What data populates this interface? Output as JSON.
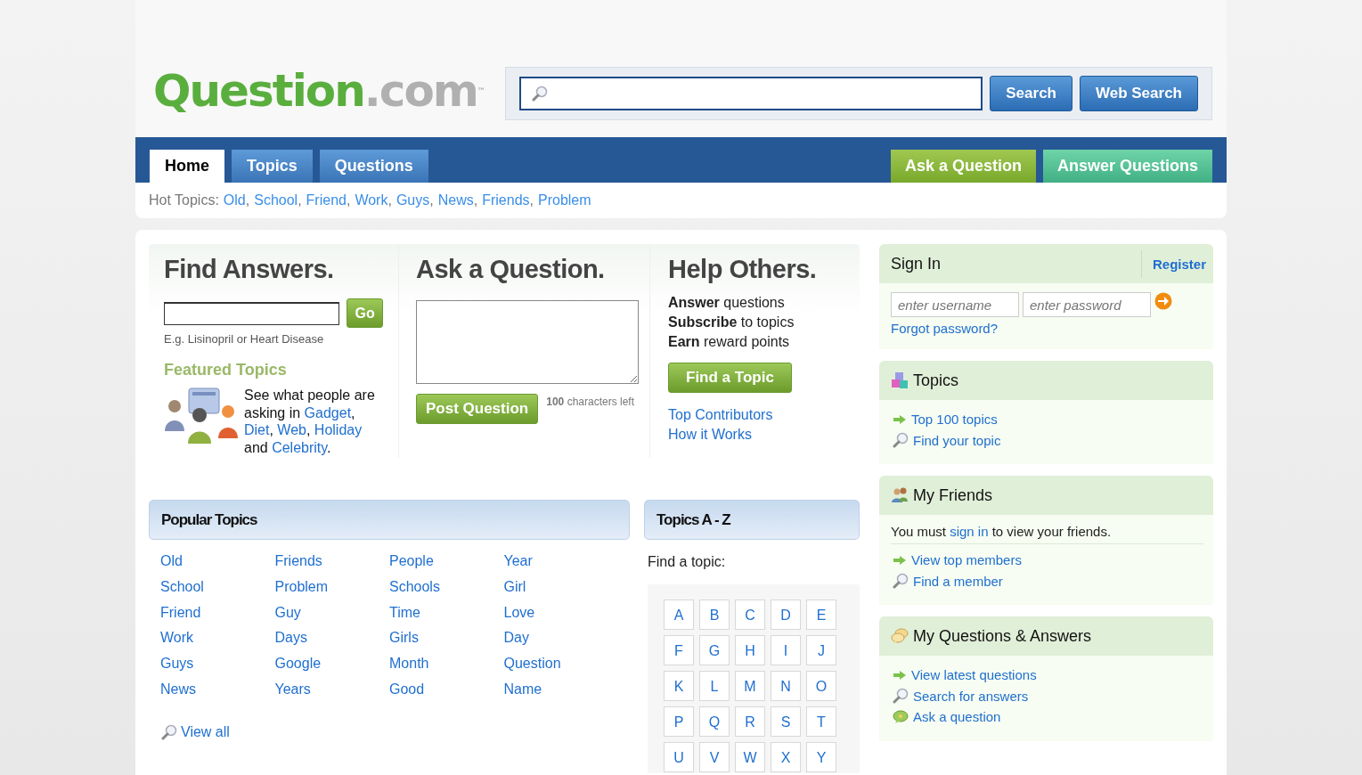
{
  "logo": {
    "name": "Question",
    "suffix": ".com",
    "mark": "™"
  },
  "search": {
    "buttons": [
      "Search",
      "Web Search"
    ]
  },
  "nav": {
    "tabs": [
      {
        "label": "Home",
        "selected": true
      },
      {
        "label": "Topics",
        "selected": false
      },
      {
        "label": "Questions",
        "selected": false
      }
    ],
    "actions": [
      {
        "label": "Ask a Question",
        "kind": "ask"
      },
      {
        "label": "Answer Questions",
        "kind": "answer"
      }
    ]
  },
  "hot_topics": {
    "label": "Hot Topics:",
    "items": [
      {
        "kind": "link",
        "text": "Old"
      },
      {
        "kind": "plain",
        "text": ","
      },
      {
        "kind": "link",
        "text": "School"
      },
      {
        "kind": "plain",
        "text": ","
      },
      {
        "kind": "link",
        "text": "Friend"
      },
      {
        "kind": "plain",
        "text": ","
      },
      {
        "kind": "link",
        "text": "Work"
      },
      {
        "kind": "plain",
        "text": ","
      },
      {
        "kind": "link",
        "text": "Guys"
      },
      {
        "kind": "plain",
        "text": ","
      },
      {
        "kind": "link",
        "text": "News"
      },
      {
        "kind": "plain",
        "text": ","
      },
      {
        "kind": "link",
        "text": "Friends"
      },
      {
        "kind": "plain",
        "text": ","
      },
      {
        "kind": "link",
        "text": "Problem"
      }
    ]
  },
  "find_answers": {
    "title": "Find Answers.",
    "button": "Go",
    "hint": "E.g. Lisinopril or Heart Disease",
    "featured_title": "Featured Topics",
    "featured_text": [
      {
        "kind": "plain",
        "text": "See what people are asking in "
      },
      {
        "kind": "link",
        "text": "Gadget"
      },
      {
        "kind": "plain",
        "text": ", "
      },
      {
        "kind": "link",
        "text": "Diet"
      },
      {
        "kind": "plain",
        "text": ", "
      },
      {
        "kind": "link",
        "text": "Web"
      },
      {
        "kind": "plain",
        "text": ", "
      },
      {
        "kind": "link",
        "text": "Holiday"
      },
      {
        "kind": "plain",
        "text": " and "
      },
      {
        "kind": "link",
        "text": "Celebrity"
      },
      {
        "kind": "plain",
        "text": "."
      }
    ]
  },
  "ask": {
    "title": "Ask a Question.",
    "button": "Post Question",
    "counter": "**100** characters left"
  },
  "help": {
    "title": "Help Others.",
    "lines": [
      "**Answer** questions",
      "**Subscribe** to topics",
      "**Earn** reward points"
    ],
    "button": "Find a Topic",
    "links": [
      "Top Contributors",
      "How it Works"
    ]
  },
  "sign_in": {
    "title": "Sign In",
    "register": "Register",
    "username": {
      "placeholder": "enter username"
    },
    "password": {
      "placeholder": "enter password"
    },
    "forgot": "Forgot password?"
  },
  "panels": [
    {
      "title": "Topics",
      "links": [
        "Top 100 topics",
        "Find your topic"
      ]
    },
    {
      "title": "My Friends",
      "note": [
        {
          "kind": "plain",
          "text": "You must "
        },
        {
          "kind": "link",
          "text": "sign in"
        },
        {
          "kind": "plain",
          "text": " to view your friends."
        }
      ],
      "links": [
        "View top members",
        "Find a member"
      ]
    },
    {
      "title": "My Questions & Answers",
      "links": [
        "View latest questions",
        "Search for answers",
        "Ask a question"
      ]
    }
  ],
  "popular_topics": {
    "title": "Popular Topics",
    "columns": [
      [
        "Old",
        "School",
        "Friend",
        "Work",
        "Guys",
        "News"
      ],
      [
        "Friends",
        "Problem",
        "Guy",
        "Days",
        "Google",
        "Years"
      ],
      [
        "People",
        "Schools",
        "Time",
        "Girls",
        "Month",
        "Good"
      ],
      [
        "Year",
        "Girl",
        "Love",
        "Day",
        "Question",
        "Name"
      ]
    ],
    "view_all": "View all"
  },
  "topics_az": {
    "title": "Topics A - Z",
    "prompt": "Find a topic:",
    "letters": [
      "A",
      "B",
      "C",
      "D",
      "E",
      "F",
      "G",
      "H",
      "I",
      "J",
      "K",
      "L",
      "M",
      "N",
      "O",
      "P",
      "Q",
      "R",
      "S",
      "T",
      "U",
      "V",
      "W",
      "X",
      "Y"
    ]
  }
}
